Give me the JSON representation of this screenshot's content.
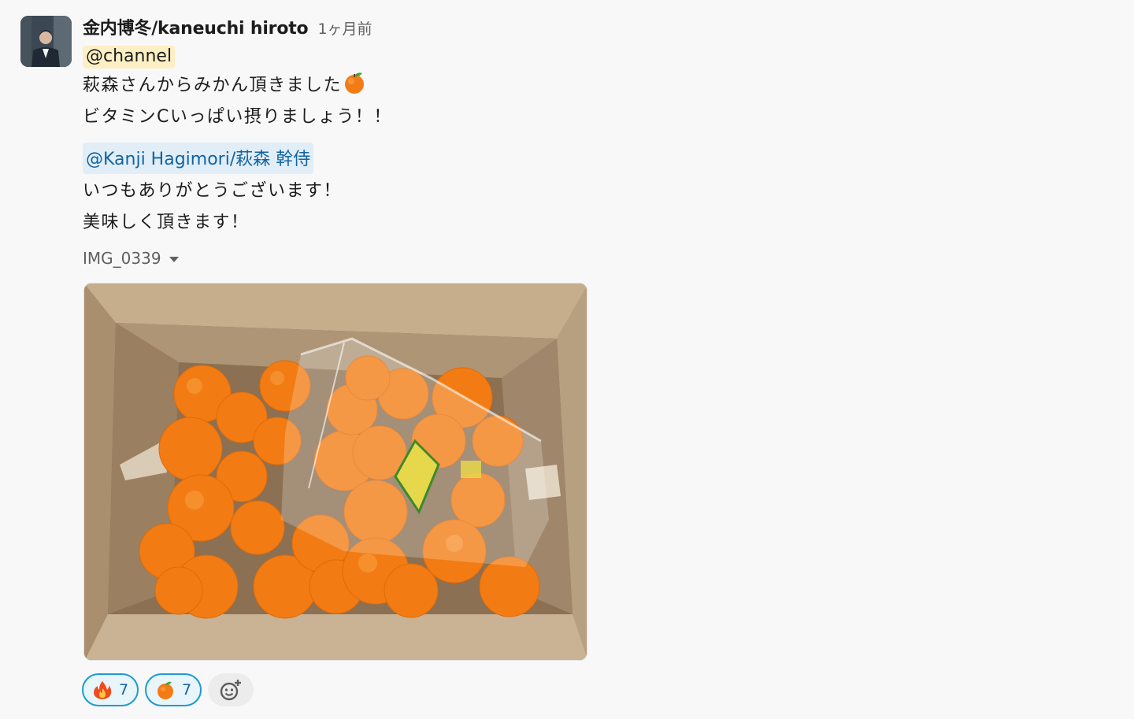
{
  "message": {
    "author": "金内博冬/kaneuchi hiroto",
    "timestamp": "1ヶ月前",
    "channel_mention": "@channel",
    "lines": [
      "萩森さんからみかん頂きました",
      "ビタミンCいっぱい摂りましょう！！"
    ],
    "user_mention": "@Kanji Hagimori/萩森 幹侍",
    "lines2": [
      "いつもありがとうございます！",
      "美味しく頂きます！"
    ]
  },
  "attachment": {
    "file_name": "IMG_0339",
    "image_icon": "photo-of-tangerines-in-box"
  },
  "reactions": [
    {
      "emoji": "fire-icon",
      "count": "7"
    },
    {
      "emoji": "tangerine-icon",
      "count": "7"
    }
  ],
  "add_reaction_icon": "add-emoji-icon",
  "colors": {
    "channel_mention_bg": "#fcefc4",
    "user_mention_bg": "#e2eef7",
    "user_mention_text": "#1264a3",
    "reaction_border": "#1d9bd1"
  }
}
